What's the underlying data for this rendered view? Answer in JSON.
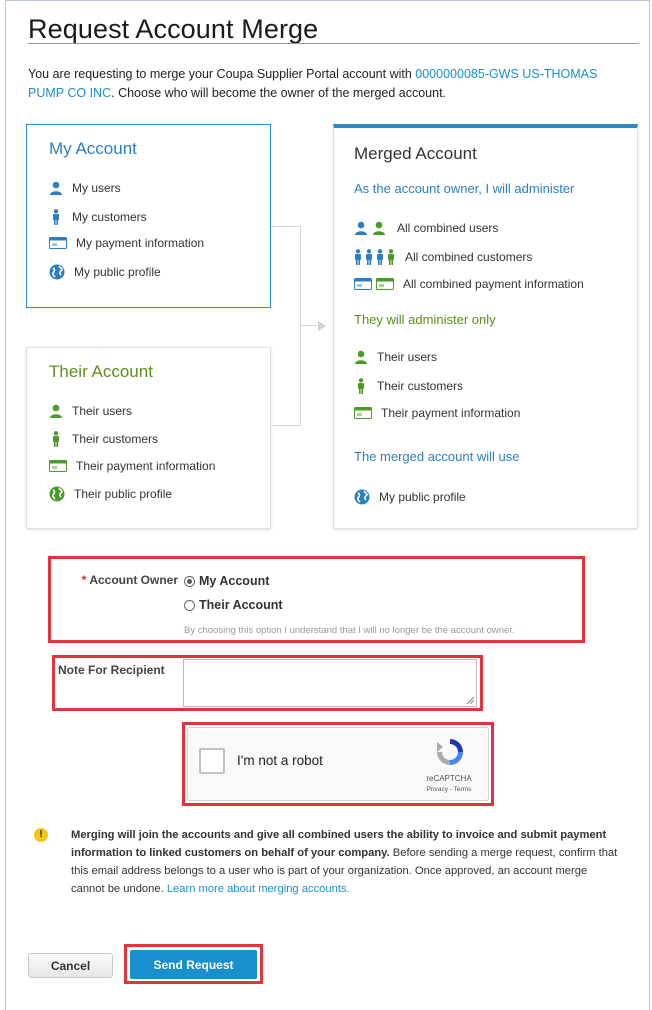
{
  "page": {
    "title": "Request Account Merge",
    "intro_before": "You are requesting to merge your Coupa Supplier Portal account with ",
    "intro_link": "0000000085-GWS US-THOMAS PUMP CO INC",
    "intro_after": ". Choose who will become the owner of the merged account."
  },
  "my_account": {
    "title": "My Account",
    "items": [
      "My users",
      "My customers",
      "My payment information",
      "My public profile"
    ]
  },
  "their_account": {
    "title": "Their Account",
    "items": [
      "Their users",
      "Their customers",
      "Their payment information",
      "Their public profile"
    ]
  },
  "merged_account": {
    "title": "Merged Account",
    "owner_heading": "As the account owner, I will administer",
    "owner_items": [
      "All combined users",
      "All combined customers",
      "All combined payment information"
    ],
    "their_heading": "They will administer only",
    "their_items": [
      "Their users",
      "Their customers",
      "Their payment information"
    ],
    "use_heading": "The merged account will use",
    "use_items": [
      "My public profile"
    ]
  },
  "form": {
    "owner_label": "Account Owner",
    "owner_required_mark": "*",
    "option_mine": "My Account",
    "option_theirs": "Their Account",
    "owner_selected": "My Account",
    "owner_hint": "By choosing this option I understand that I will no longer be the account owner.",
    "note_label": "Note For Recipient",
    "note_value": ""
  },
  "captcha": {
    "label": "I'm not a robot",
    "brand": "reCAPTCHA",
    "links": "Privacy - Terms"
  },
  "warning": {
    "bold": "Merging will join the accounts and give all combined users the ability to invoice and submit payment information to linked customers on behalf of your company.",
    "text": " Before sending a merge request, confirm that this email address belongs to a user who is part of your organization. Once approved, an account merge cannot be undone. ",
    "link": "Learn more about merging accounts."
  },
  "buttons": {
    "cancel": "Cancel",
    "send": "Send Request"
  },
  "colors": {
    "accent_blue": "#1a8fce",
    "their_green": "#5b8f1d",
    "highlight_red": "#e2343f"
  }
}
